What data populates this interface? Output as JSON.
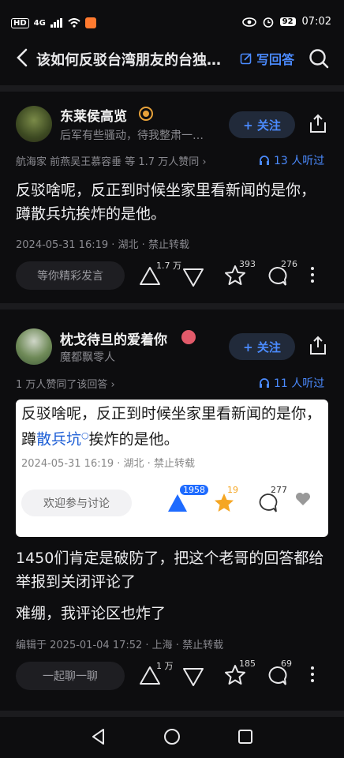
{
  "status": {
    "left_badges": [
      "HD",
      "4G"
    ],
    "battery": "92",
    "time": "07:02"
  },
  "header": {
    "title": "该如何反驳台湾朋友的台独…",
    "write_label": "写回答"
  },
  "answer1": {
    "author": "东莱侯高览",
    "bio": "后军有些骚动，待我整肃一…",
    "follow_label": "+ 关注",
    "upvoters": "航海家 前燕吴王慕容垂 等 1.7 万人赞同 ›",
    "listen": "13 人听过",
    "text": "反驳啥呢，反正到时候坐家里看新闻的是你，蹲散兵坑挨炸的是他。",
    "date": "2024-05-31 16:19 · 湖北 · 禁止转载",
    "comment_placeholder": "等你精彩发言",
    "upvote_count": "1.7 万",
    "like_count": "393",
    "comment_count": "276"
  },
  "answer2": {
    "author": "枕戈待旦的爱着你",
    "bio": "魔都飘零人",
    "follow_label": "+ 关注",
    "upvoters": "1 万人赞同了该回答 ›",
    "listen": "11 人听过",
    "embed": {
      "text_before": "反驳啥呢，反正到时候坐家里看新闻的是你，蹲",
      "link": "散兵坑",
      "text_after": "挨炸的是他。",
      "date": "2024-05-31 16:19 · 湖北 · 禁止转载",
      "comment_placeholder": "欢迎参与讨论",
      "upvote_count": "1958",
      "star_count": "19",
      "comment_count": "277"
    },
    "text1": "1450们肯定是破防了，把这个老哥的回答都给举报到关闭评论了",
    "text2": "难绷，我评论区也炸了",
    "date": "编辑于 2025-01-04 17:52 · 上海 · 禁止转载",
    "comment_placeholder": "一起聊一聊",
    "upvote_count": "1 万",
    "like_count": "185",
    "comment_count": "69"
  },
  "colors": {
    "accent": "#4b8bff",
    "background": "#0d0d0f",
    "divider": "#1b1b1e"
  }
}
